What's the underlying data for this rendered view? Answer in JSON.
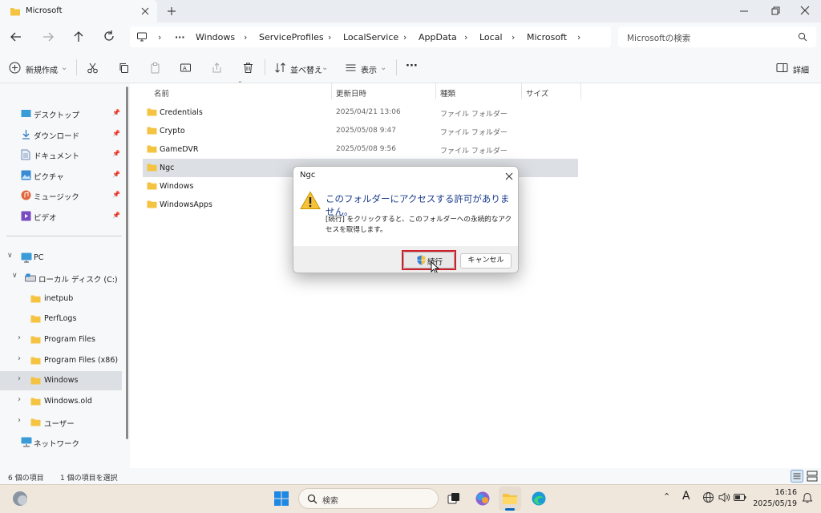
{
  "window": {
    "tab_title": "Microsoft",
    "colors": {
      "accent": "#0067c0",
      "folder": "#f5c342",
      "dialog_heading": "#1a3c8c",
      "highlight": "#d0202a"
    }
  },
  "navigation": {
    "more": "···",
    "breadcrumbs": [
      "Windows",
      "ServiceProfiles",
      "LocalService",
      "AppData",
      "Local",
      "Microsoft"
    ],
    "search_placeholder": "Microsoftの検索"
  },
  "commands": {
    "new": "新規作成",
    "sort": "並べ替え",
    "view": "表示",
    "more": "···",
    "details": "詳細"
  },
  "sidebar": {
    "quick_access": [
      {
        "label": "デスクトップ",
        "icon": "desktop-icon"
      },
      {
        "label": "ダウンロード",
        "icon": "download-icon"
      },
      {
        "label": "ドキュメント",
        "icon": "document-icon"
      },
      {
        "label": "ピクチャ",
        "icon": "picture-icon"
      },
      {
        "label": "ミュージック",
        "icon": "music-icon"
      },
      {
        "label": "ビデオ",
        "icon": "video-icon"
      }
    ],
    "pc": "PC",
    "drive": "ローカル ディスク (C:)",
    "folders": [
      "inetpub",
      "PerfLogs",
      "Program Files",
      "Program Files (x86)",
      "Windows",
      "Windows.old",
      "ユーザー"
    ],
    "network": "ネットワーク"
  },
  "columns": {
    "name": "名前",
    "date": "更新日時",
    "type": "種類",
    "size": "サイズ"
  },
  "files": [
    {
      "name": "Credentials",
      "date": "2025/04/21 13:06",
      "type": "ファイル フォルダー"
    },
    {
      "name": "Crypto",
      "date": "2025/05/08 9:47",
      "type": "ファイル フォルダー"
    },
    {
      "name": "GameDVR",
      "date": "2025/05/08 9:56",
      "type": "ファイル フォルダー"
    },
    {
      "name": "Ngc",
      "date": "",
      "type": ""
    },
    {
      "name": "Windows",
      "date": "",
      "type": ""
    },
    {
      "name": "WindowsApps",
      "date": "",
      "type": ""
    }
  ],
  "status": {
    "count": "6 個の項目",
    "selected": "1 個の項目を選択"
  },
  "dialog": {
    "title": "Ngc",
    "heading": "このフォルダーにアクセスする許可がありません。",
    "body": "[続行] をクリックすると、このフォルダーへの永続的なアクセスを取得します。",
    "continue_label": "続行",
    "cancel_label": "キャンセル"
  },
  "taskbar": {
    "search_label": "検索",
    "ime": "A",
    "time": "16:16",
    "date": "2025/05/19"
  }
}
